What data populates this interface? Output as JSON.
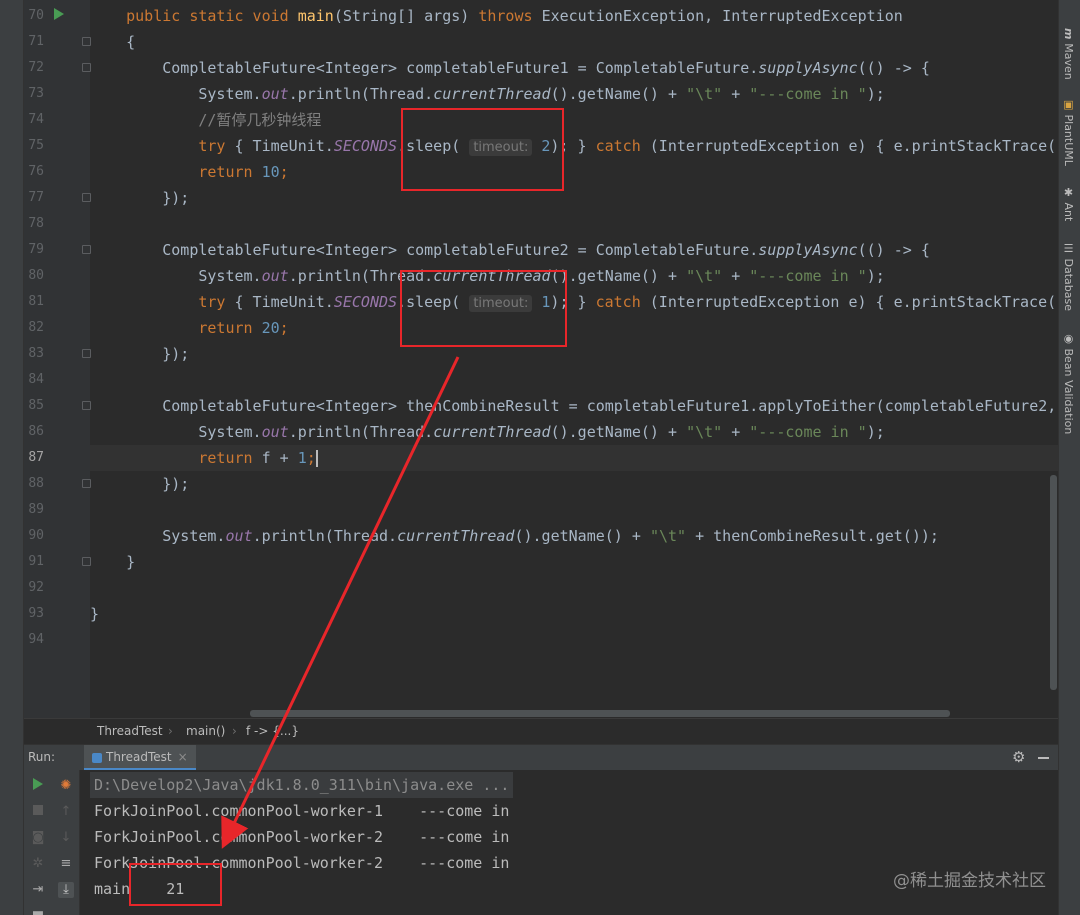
{
  "editor": {
    "lines": [
      {
        "n": "70",
        "tokens": [
          [
            "kw",
            "    public static void "
          ],
          [
            "fn",
            "main"
          ],
          [
            "",
            "(String[] args) "
          ],
          [
            "kw",
            "throws "
          ],
          [
            "",
            "ExecutionException, InterruptedException"
          ]
        ]
      },
      {
        "n": "71",
        "tokens": [
          [
            "",
            "    {"
          ]
        ]
      },
      {
        "n": "72",
        "tokens": [
          [
            "",
            "        CompletableFuture<Integer> completableFuture1 = CompletableFuture."
          ],
          [
            "it",
            "supplyAsync"
          ],
          [
            "",
            "(() -> {"
          ]
        ]
      },
      {
        "n": "73",
        "tokens": [
          [
            "",
            "            System."
          ],
          [
            "st",
            "out"
          ],
          [
            "",
            ".println(Thread."
          ],
          [
            "it",
            "currentThread"
          ],
          [
            "",
            "().getName() + "
          ],
          [
            "str",
            "\"\\t\""
          ],
          [
            "",
            " + "
          ],
          [
            "str",
            "\"---come in \""
          ],
          [
            "",
            ");"
          ]
        ]
      },
      {
        "n": "74",
        "tokens": [
          [
            "cm",
            "            //暂停几秒钟线程"
          ]
        ]
      },
      {
        "n": "75",
        "tokens": [
          [
            "kw",
            "            try "
          ],
          [
            "",
            "{ TimeUnit."
          ],
          [
            "st",
            "SECONDS"
          ],
          [
            "",
            ".sleep( "
          ],
          [
            "hint",
            "timeout:"
          ],
          [
            "",
            " "
          ],
          [
            "num",
            "2"
          ],
          [
            "",
            "); } "
          ],
          [
            "kw",
            "catch "
          ],
          [
            "",
            "(InterruptedException e) { e.printStackTrace();"
          ]
        ]
      },
      {
        "n": "76",
        "tokens": [
          [
            "kw",
            "            return "
          ],
          [
            "num",
            "10"
          ],
          [
            "kw",
            ";"
          ]
        ]
      },
      {
        "n": "77",
        "tokens": [
          [
            "",
            "        });"
          ]
        ]
      },
      {
        "n": "78",
        "tokens": [
          [
            "",
            ""
          ]
        ]
      },
      {
        "n": "79",
        "tokens": [
          [
            "",
            "        CompletableFuture<Integer> completableFuture2 = CompletableFuture."
          ],
          [
            "it",
            "supplyAsync"
          ],
          [
            "",
            "(() -> {"
          ]
        ]
      },
      {
        "n": "80",
        "tokens": [
          [
            "",
            "            System."
          ],
          [
            "st",
            "out"
          ],
          [
            "",
            ".println(Thread."
          ],
          [
            "it",
            "currentThread"
          ],
          [
            "",
            "().getName() + "
          ],
          [
            "str",
            "\"\\t\""
          ],
          [
            "",
            " + "
          ],
          [
            "str",
            "\"---come in \""
          ],
          [
            "",
            ");"
          ]
        ]
      },
      {
        "n": "81",
        "tokens": [
          [
            "kw",
            "            try "
          ],
          [
            "",
            "{ TimeUnit."
          ],
          [
            "st",
            "SECONDS"
          ],
          [
            "",
            ".sleep( "
          ],
          [
            "hint",
            "timeout:"
          ],
          [
            "",
            " "
          ],
          [
            "num",
            "1"
          ],
          [
            "",
            "); } "
          ],
          [
            "kw",
            "catch "
          ],
          [
            "",
            "(InterruptedException e) { e.printStackTrace();"
          ]
        ]
      },
      {
        "n": "82",
        "tokens": [
          [
            "kw",
            "            return "
          ],
          [
            "num",
            "20"
          ],
          [
            "kw",
            ";"
          ]
        ]
      },
      {
        "n": "83",
        "tokens": [
          [
            "",
            "        });"
          ]
        ]
      },
      {
        "n": "84",
        "tokens": [
          [
            "",
            ""
          ]
        ]
      },
      {
        "n": "85",
        "tokens": [
          [
            "",
            "        CompletableFuture<Integer> thenCombineResult = completableFuture1.applyToEither(completableFuture2,"
          ]
        ]
      },
      {
        "n": "86",
        "tokens": [
          [
            "",
            "            System."
          ],
          [
            "st",
            "out"
          ],
          [
            "",
            ".println(Thread."
          ],
          [
            "it",
            "currentThread"
          ],
          [
            "",
            "().getName() + "
          ],
          [
            "str",
            "\"\\t\""
          ],
          [
            "",
            " + "
          ],
          [
            "str",
            "\"---come in \""
          ],
          [
            "",
            ");"
          ]
        ]
      },
      {
        "n": "87",
        "tokens": [
          [
            "kw",
            "            return "
          ],
          [
            "",
            "f + "
          ],
          [
            "num",
            "1"
          ],
          [
            "kw",
            ";"
          ]
        ]
      },
      {
        "n": "88",
        "tokens": [
          [
            "",
            "        });"
          ]
        ]
      },
      {
        "n": "89",
        "tokens": [
          [
            "",
            ""
          ]
        ]
      },
      {
        "n": "90",
        "tokens": [
          [
            "",
            "        System."
          ],
          [
            "st",
            "out"
          ],
          [
            "",
            ".println(Thread."
          ],
          [
            "it",
            "currentThread"
          ],
          [
            "",
            "().getName() + "
          ],
          [
            "str",
            "\"\\t\""
          ],
          [
            "",
            " + thenCombineResult.get());"
          ]
        ]
      },
      {
        "n": "91",
        "tokens": [
          [
            "",
            "    }"
          ]
        ]
      },
      {
        "n": "92",
        "tokens": [
          [
            "",
            ""
          ]
        ]
      },
      {
        "n": "93",
        "tokens": [
          [
            "",
            "}"
          ]
        ]
      },
      {
        "n": "94",
        "tokens": [
          [
            "",
            ""
          ]
        ]
      }
    ],
    "current_line": "87"
  },
  "breadcrumb": {
    "file": "ThreadTest",
    "method": "main()",
    "lambda": "f -> {...}"
  },
  "run_panel": {
    "label": "Run:",
    "tab": "ThreadTest",
    "close": "×",
    "settings_icon": "gear-icon",
    "minimize_icon": "minimize-icon"
  },
  "console": {
    "command": "D:\\Develop2\\Java\\jdk1.8.0_311\\bin\\java.exe ...",
    "lines": [
      "ForkJoinPool.commonPool-worker-1    ---come in",
      "ForkJoinPool.commonPool-worker-2    ---come in",
      "ForkJoinPool.commonPool-worker-2    ---come in",
      "main    21"
    ]
  },
  "tool_windows": {
    "maven": "Maven",
    "plantuml": "PlantUML",
    "ant": "Ant",
    "database": "Database",
    "bean_validation": "Bean Validation"
  },
  "watermark": "@稀土掘金技术社区",
  "colors": {
    "annotation": "#e8262a",
    "background": "#2b2b2b",
    "keyword": "#cc7832",
    "string": "#6a8759",
    "number": "#6897bb"
  }
}
